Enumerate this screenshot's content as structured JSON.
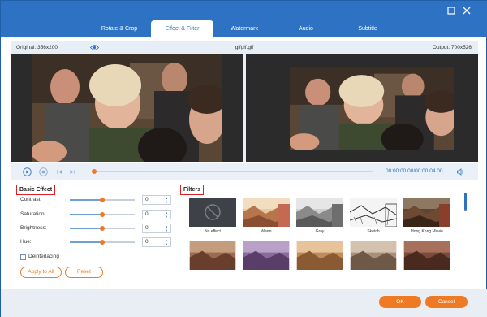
{
  "window": {
    "tabs": [
      {
        "label": "Rotate & Crop"
      },
      {
        "label": "Effect & Filter"
      },
      {
        "label": "Watermark"
      },
      {
        "label": "Audio"
      },
      {
        "label": "Subtitle"
      }
    ],
    "active_tab": "Effect & Filter"
  },
  "info": {
    "original": "Original: 356x200",
    "filename": "gifgif.gif",
    "output": "Output: 700x526"
  },
  "playback": {
    "time": "00:00:00.00/00:00:04.00",
    "progress_fraction": 0.0
  },
  "basic_effect": {
    "title": "Basic Effect",
    "rows": [
      {
        "label": "Contrast:",
        "value": "0",
        "level": 0.5
      },
      {
        "label": "Saturation:",
        "value": "0",
        "level": 0.5
      },
      {
        "label": "Brightness:",
        "value": "0",
        "level": 0.5
      },
      {
        "label": "Hue:",
        "value": "0",
        "level": 0.5
      }
    ],
    "deinterlace_label": "Deinterlacing",
    "apply_label": "Apply to All",
    "reset_label": "Reset"
  },
  "filters": {
    "title": "Filters",
    "items": [
      {
        "label": "No effect"
      },
      {
        "label": "Warm"
      },
      {
        "label": "Gray"
      },
      {
        "label": "Sketch"
      },
      {
        "label": "Hong Kong Movie"
      }
    ]
  },
  "footer": {
    "ok_label": "OK",
    "cancel_label": "Cancel"
  },
  "colors": {
    "brand": "#2e72c4",
    "accent": "#f07a24",
    "highlight": "#e02020"
  }
}
